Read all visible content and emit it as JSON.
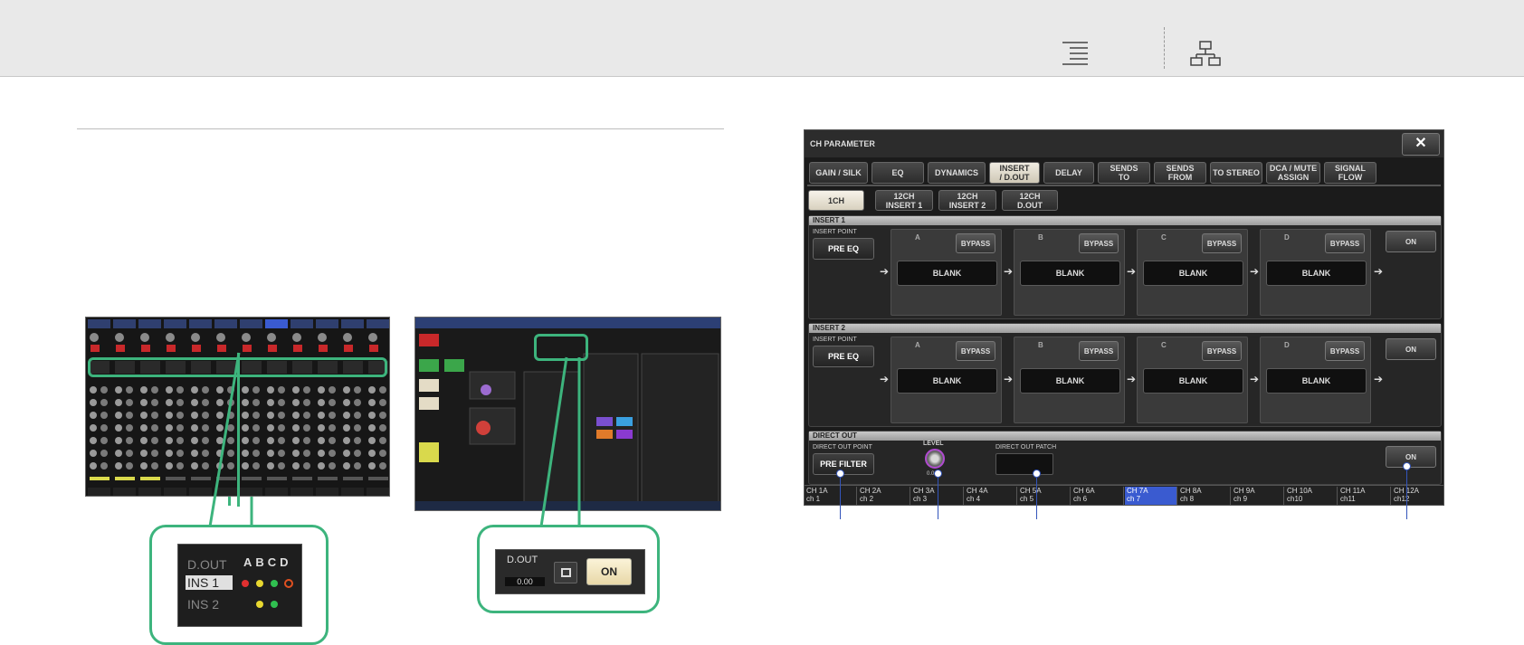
{
  "toolbar": {
    "menu_icon": "list-icon",
    "hierarchy_icon": "sitemap-icon"
  },
  "callout_ins": {
    "rows": [
      "D.OUT",
      "INS 1",
      "INS 2"
    ],
    "letters": "ABCD"
  },
  "callout_dout": {
    "label": "D.OUT",
    "value": "0.00",
    "on": "ON"
  },
  "panel": {
    "title": "CH PARAMETER",
    "close_symbol": "✕",
    "tabs": [
      "GAIN / SILK",
      "EQ",
      "DYNAMICS",
      "INSERT\n/ D.OUT",
      "DELAY",
      "SENDS\nTO",
      "SENDS\nFROM",
      "TO STEREO",
      "DCA / MUTE\nASSIGN",
      "SIGNAL\nFLOW"
    ],
    "subtabs": [
      "1CH",
      "12CH\nINSERT 1",
      "12CH\nINSERT 2",
      "12CH\nD.OUT"
    ],
    "insert1": {
      "title": "INSERT 1",
      "point_label": "INSERT POINT",
      "point_value": "PRE EQ"
    },
    "insert2": {
      "title": "INSERT 2",
      "point_label": "INSERT POINT",
      "point_value": "PRE EQ"
    },
    "slots": [
      "A",
      "B",
      "C",
      "D"
    ],
    "bypass_label": "BYPASS",
    "blank_label": "BLANK",
    "on_label": "ON",
    "direct_out": {
      "title": "DIRECT OUT",
      "point_label": "DIRECT OUT POINT",
      "point_value": "PRE FILTER",
      "level_label": "LEVEL",
      "level_value": "0.00",
      "patch_label": "DIRECT OUT PATCH",
      "on_label": "ON"
    },
    "channels": [
      {
        "name": "CH 1A",
        "sub": "ch 1"
      },
      {
        "name": "CH 2A",
        "sub": "ch 2"
      },
      {
        "name": "CH 3A",
        "sub": "ch 3"
      },
      {
        "name": "CH 4A",
        "sub": "ch 4"
      },
      {
        "name": "CH 5A",
        "sub": "ch 5"
      },
      {
        "name": "CH 6A",
        "sub": "ch 6"
      },
      {
        "name": "CH 7A",
        "sub": "ch 7"
      },
      {
        "name": "CH 8A",
        "sub": "ch 8"
      },
      {
        "name": "CH 9A",
        "sub": "ch 9"
      },
      {
        "name": "CH 10A",
        "sub": "ch10"
      },
      {
        "name": "CH 11A",
        "sub": "ch11"
      },
      {
        "name": "CH 12A",
        "sub": "ch12"
      }
    ],
    "selected_channel": "CH 7A"
  },
  "colors": {
    "accent_green": "#3db47d",
    "selected_blue": "#3a5bd0",
    "pointer_blue": "#3355bb"
  }
}
